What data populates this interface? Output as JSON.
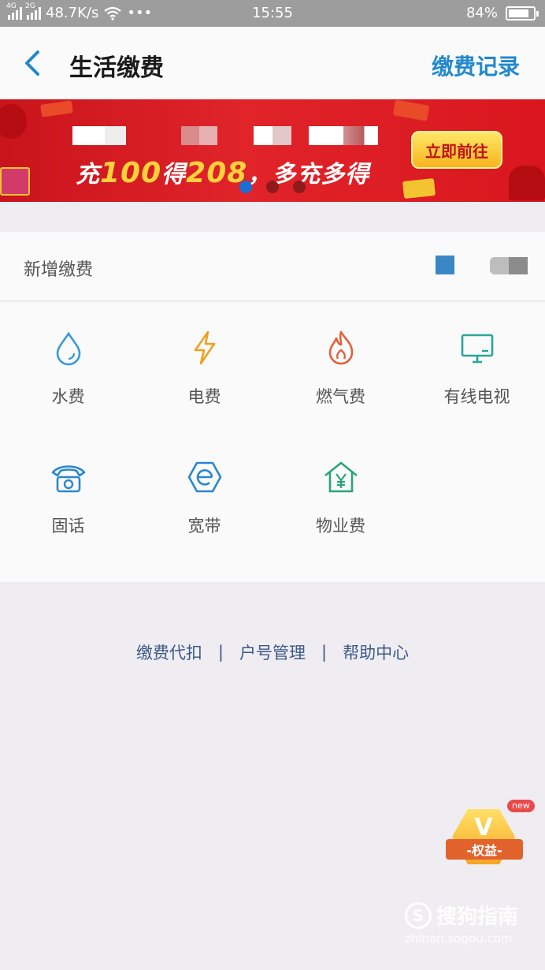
{
  "status_bar": {
    "net_4g": "4G",
    "net_2g": "2G",
    "speed": "48.7K/s",
    "more": "•••",
    "time": "15:55",
    "battery": "84%",
    "battery_level": 0.84
  },
  "nav": {
    "title": "生活缴费",
    "right_link": "缴费记录"
  },
  "banner": {
    "slogan_prefix": "充",
    "slogan_num1": "100",
    "slogan_mid": "得",
    "slogan_num2": "208",
    "slogan_suffix": "，多充多得",
    "button": "立即前往",
    "active_dot": 0,
    "dots": 3
  },
  "add_row": {
    "label": "新增缴费"
  },
  "services": [
    {
      "label": "水费",
      "icon": "water-drop-icon",
      "color": "#3a9ad9"
    },
    {
      "label": "电费",
      "icon": "lightning-icon",
      "color": "#f0a020"
    },
    {
      "label": "燃气费",
      "icon": "flame-icon",
      "color": "#e4603a"
    },
    {
      "label": "有线电视",
      "icon": "tv-icon",
      "color": "#2aa59a"
    },
    {
      "label": "固话",
      "icon": "telephone-icon",
      "color": "#2a88cc"
    },
    {
      "label": "宽带",
      "icon": "broadband-icon",
      "color": "#2a88cc"
    },
    {
      "label": "物业费",
      "icon": "house-yuan-icon",
      "color": "#2aa57a"
    }
  ],
  "footer": {
    "link1": "缴费代扣",
    "link2": "户号管理",
    "link3": "帮助中心",
    "sep": "|"
  },
  "badge": {
    "letter": "V",
    "label": "-权益-",
    "new": "new"
  },
  "watermark": {
    "brand": "搜狗指南",
    "url": "zhinan.sogou.com"
  }
}
